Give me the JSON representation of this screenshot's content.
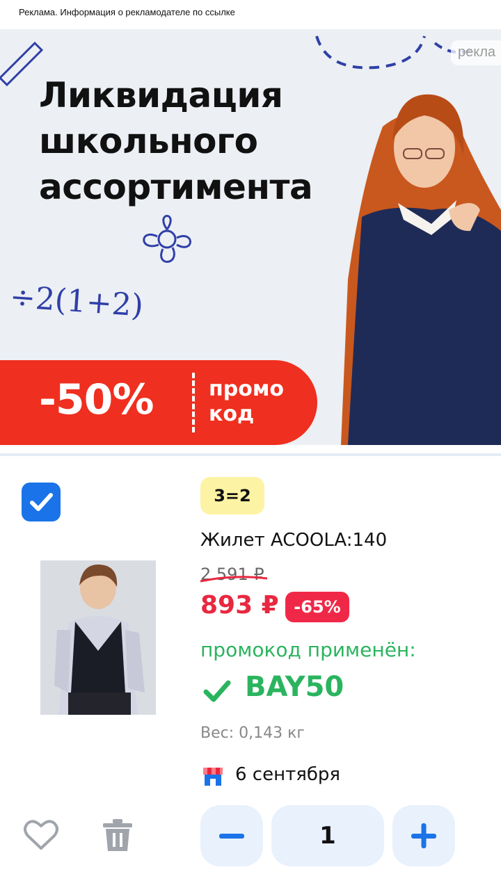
{
  "ad_notice": "Реклама. Информация о рекламодателе по ссылке",
  "banner": {
    "title_lines": [
      "Ликвидация",
      "школьного",
      "ассортимента"
    ],
    "ad_chip": "рекла",
    "doodle_text": "÷2(1+2)",
    "discount": "-50%",
    "promo_lines": [
      "промо",
      "код"
    ],
    "accent_color": "#ef2f1f"
  },
  "item": {
    "selected": true,
    "deal_badge": "3=2",
    "name": "Жилет ACOOLA:140",
    "old_price": "2 591 ₽",
    "price": "893 ₽",
    "discount_badge": "-65%",
    "promo_applied_label": "промокод применён:",
    "promo_code": "BAY50",
    "weight": "Вес: 0,143 кг",
    "delivery_date": "6 сентября",
    "quantity": "1",
    "icons": {
      "checkbox": "checkmark-icon",
      "favorite": "heart-icon",
      "delete": "trash-icon",
      "store": "store-icon",
      "minus": "minus-icon",
      "plus": "plus-icon"
    },
    "colors": {
      "price": "#e8283f",
      "promo_green": "#2bb45f",
      "primary_blue": "#1a73e8",
      "deal_yellow": "#fdf3a4"
    }
  }
}
